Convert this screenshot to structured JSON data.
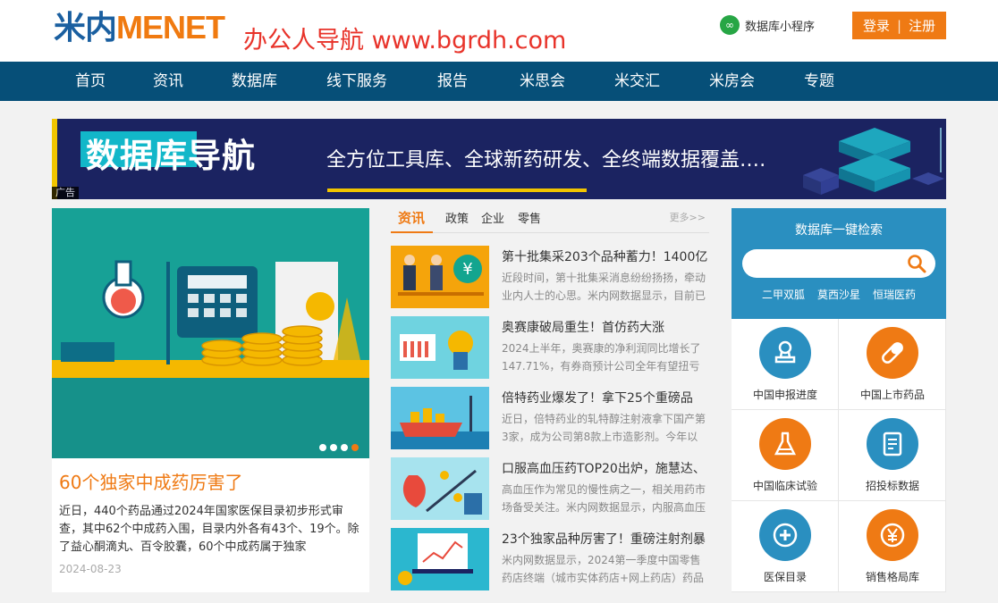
{
  "header": {
    "logo_cn": "米内",
    "logo_en": "MENET",
    "watermark": "办公人导航 www.bgrdh.com",
    "mini_program": "数据库小程序",
    "login": "登录",
    "register": "注册"
  },
  "nav": {
    "items": [
      "首页",
      "资讯",
      "数据库",
      "线下服务",
      "报告",
      "米思会",
      "米交汇",
      "米房会",
      "专题"
    ]
  },
  "banner": {
    "title": "数据库导航",
    "slogan": "全方位工具库、全球新药研发、全终端数据覆盖……",
    "ad_label": "广告"
  },
  "feature": {
    "title": "60个独家中成药厉害了",
    "description": "近日，440个药品通过2024年国家医保目录初步形式审查，其中62个中成药入围，目录内外各有43个、19个。除了益心酮滴丸、百令胶囊，60个中成药属于独家",
    "date": "2024-08-23",
    "slides": 4,
    "active_slide": 4
  },
  "news": {
    "tabs": [
      "资讯",
      "政策",
      "企业",
      "零售"
    ],
    "more": "更多>>",
    "items": [
      {
        "title": "第十批集采203个品种蓄力！1400亿",
        "desc": "近段时间，第十批集采消息纷纷扬扬，牵动业内人士的心思。米内网数据显示，目前已"
      },
      {
        "title": "奥赛康破局重生！首仿药大涨",
        "desc": "2024上半年，奥赛康的净利润同比增长了147.71%，有券商预计公司全年有望扭亏为"
      },
      {
        "title": "倍特药业爆发了！拿下25个重磅品",
        "desc": "近日，倍特药业的轧特醇注射液拿下国产第3家，成为公司第8款上市造影剂。今年以"
      },
      {
        "title": "口服高血压药TOP20出炉，施慧达、",
        "desc": "高血压作为常见的慢性病之一，相关用药市场备受关注。米内网数据显示，内服高血压"
      },
      {
        "title": "23个独家品种厉害了！重磅注射剂暴",
        "desc": "米内网数据显示，2024第一季度中国零售药店终端（城市实体药店+网上药店）药品"
      }
    ]
  },
  "sidebar": {
    "search_title": "数据库一键检索",
    "search_placeholder": "",
    "hot_links": [
      "二甲双胍",
      "莫西沙星",
      "恒瑞医药"
    ],
    "tools": [
      {
        "label": "中国申报进度",
        "icon": "stamp-icon",
        "color": "#2a8fc0"
      },
      {
        "label": "中国上市药品",
        "icon": "pill-icon",
        "color": "#ef7a14"
      },
      {
        "label": "中国临床试验",
        "icon": "flask-icon",
        "color": "#ef7a14"
      },
      {
        "label": "招投标数据",
        "icon": "document-icon",
        "color": "#2a8fc0"
      },
      {
        "label": "医保目录",
        "icon": "plus-circle-icon",
        "color": "#2a8fc0"
      },
      {
        "label": "销售格局库",
        "icon": "yen-icon",
        "color": "#ef7a14"
      }
    ]
  },
  "colors": {
    "brand_blue": "#064f78",
    "accent_orange": "#ef7a14",
    "search_blue": "#2a8fc0",
    "watermark_red": "#e8332a"
  }
}
